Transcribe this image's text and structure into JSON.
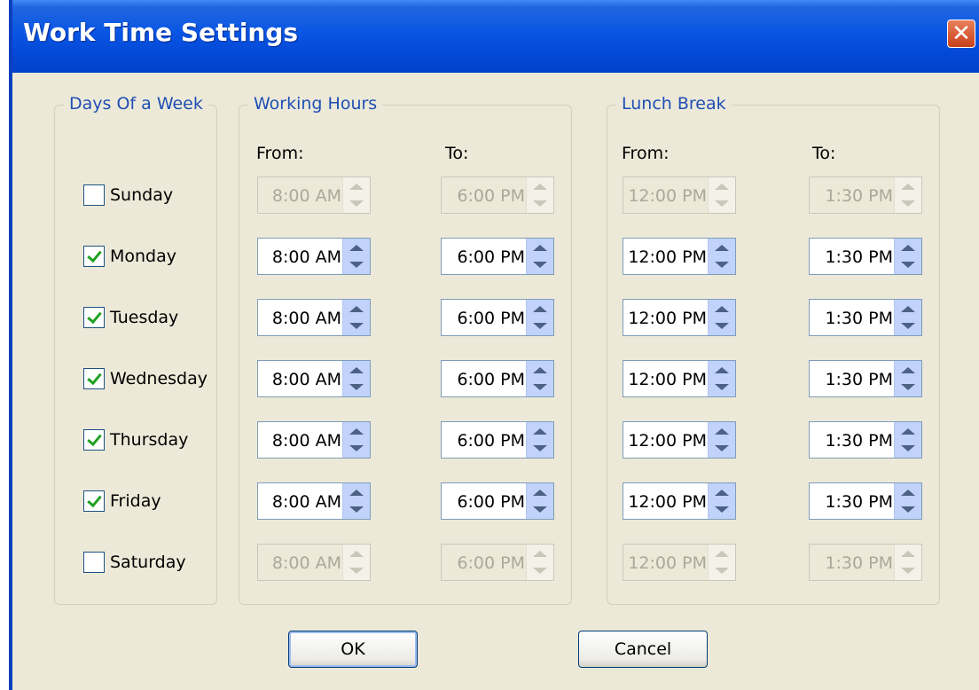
{
  "window": {
    "title": "Work Time Settings",
    "close_symbol": "✕"
  },
  "days": {
    "legend": "Days Of a Week",
    "items": [
      {
        "label": "Sunday",
        "checked": false
      },
      {
        "label": "Monday",
        "checked": true
      },
      {
        "label": "Tuesday",
        "checked": true
      },
      {
        "label": "Wednesday",
        "checked": true
      },
      {
        "label": "Thursday",
        "checked": true
      },
      {
        "label": "Friday",
        "checked": true
      },
      {
        "label": "Saturday",
        "checked": false
      }
    ]
  },
  "working_hours": {
    "legend": "Working Hours",
    "from_label": "From:",
    "to_label": "To:",
    "rows": [
      {
        "from": "8:00 AM",
        "to": "6:00 PM",
        "enabled": false
      },
      {
        "from": "8:00 AM",
        "to": "6:00 PM",
        "enabled": true
      },
      {
        "from": "8:00 AM",
        "to": "6:00 PM",
        "enabled": true
      },
      {
        "from": "8:00 AM",
        "to": "6:00 PM",
        "enabled": true
      },
      {
        "from": "8:00 AM",
        "to": "6:00 PM",
        "enabled": true
      },
      {
        "from": "8:00 AM",
        "to": "6:00 PM",
        "enabled": true
      },
      {
        "from": "8:00 AM",
        "to": "6:00 PM",
        "enabled": false
      }
    ]
  },
  "lunch_break": {
    "legend": "Lunch Break",
    "from_label": "From:",
    "to_label": "To:",
    "rows": [
      {
        "from": "12:00 PM",
        "to": "1:30 PM",
        "enabled": false
      },
      {
        "from": "12:00 PM",
        "to": "1:30 PM",
        "enabled": true
      },
      {
        "from": "12:00 PM",
        "to": "1:30 PM",
        "enabled": true
      },
      {
        "from": "12:00 PM",
        "to": "1:30 PM",
        "enabled": true
      },
      {
        "from": "12:00 PM",
        "to": "1:30 PM",
        "enabled": true
      },
      {
        "from": "12:00 PM",
        "to": "1:30 PM",
        "enabled": true
      },
      {
        "from": "12:00 PM",
        "to": "1:30 PM",
        "enabled": false
      }
    ]
  },
  "buttons": {
    "ok": "OK",
    "cancel": "Cancel"
  }
}
